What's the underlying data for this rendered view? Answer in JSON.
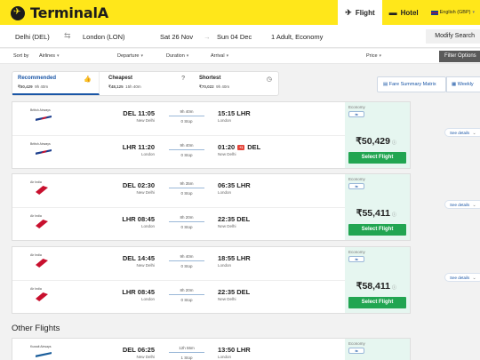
{
  "header": {
    "brand": "TerminalA",
    "nav": [
      {
        "label": "Flight",
        "icon": "✈",
        "active": true
      },
      {
        "label": "Hotel",
        "icon": "▬",
        "active": false
      }
    ],
    "language": "English (GBP)"
  },
  "search": {
    "from": "Delhi (DEL)",
    "to": "London (LON)",
    "depart_date": "Sat 26 Nov",
    "return_date": "Sun 04 Dec",
    "travellers": "1 Adult, Economy",
    "modify_label": "Modify Search"
  },
  "sort": {
    "sort_by": "Sort by",
    "airlines": "Airlines",
    "departure": "Departure",
    "duration": "Duration",
    "arrival": "Arrival",
    "price": "Price",
    "filter_label": "Filter Options"
  },
  "tabs": [
    {
      "name": "Recommended",
      "price": "₹50,429",
      "time": "9h 40m",
      "icon": "👍"
    },
    {
      "name": "Cheapest",
      "price": "₹48,125",
      "time": "15h 40m",
      "icon": "?"
    },
    {
      "name": "Shortest",
      "price": "₹70,022",
      "time": "9h 40m",
      "icon": "◷"
    }
  ],
  "tools": {
    "fare_summary": "Fare Summary Matrix",
    "weekly": "Weekly"
  },
  "cards": [
    {
      "cabin": "Economy",
      "price": "₹50,429",
      "select_label": "Select Flight",
      "details_label": "See details",
      "legs": [
        {
          "airline": "British Airways",
          "logo": "ba",
          "dep_time": "DEL 11:05",
          "dep_city": "New Delhi",
          "duration": "9h 40m",
          "stops": "0 Stop",
          "arr_time": "15:15 LHR",
          "arr_city": "London",
          "plus": ""
        },
        {
          "airline": "British Airways",
          "logo": "ba",
          "dep_time": "LHR 11:20",
          "dep_city": "London",
          "duration": "9h 40m",
          "stops": "0 Stop",
          "arr_time": "01:20",
          "arr_code": "DEL",
          "arr_city": "New Delhi",
          "plus": "+1"
        }
      ]
    },
    {
      "cabin": "Economy",
      "price": "₹55,411",
      "select_label": "Select Flight",
      "details_label": "See details",
      "legs": [
        {
          "airline": "Air India",
          "logo": "ai",
          "dep_time": "DEL 02:30",
          "dep_city": "New Delhi",
          "duration": "9h 35m",
          "stops": "0 Stop",
          "arr_time": "06:35 LHR",
          "arr_city": "London",
          "plus": ""
        },
        {
          "airline": "Air India",
          "logo": "ai",
          "dep_time": "LHR 08:45",
          "dep_city": "London",
          "duration": "8h 20m",
          "stops": "0 Stop",
          "arr_time": "22:35 DEL",
          "arr_city": "New Delhi",
          "plus": ""
        }
      ]
    },
    {
      "cabin": "Economy",
      "price": "₹58,411",
      "select_label": "Select Flight",
      "details_label": "See details",
      "legs": [
        {
          "airline": "Air India",
          "logo": "ai",
          "dep_time": "DEL 14:45",
          "dep_city": "New Delhi",
          "duration": "9h 40m",
          "stops": "0 Stop",
          "arr_time": "18:55 LHR",
          "arr_city": "London",
          "plus": ""
        },
        {
          "airline": "Air India",
          "logo": "ai",
          "dep_time": "LHR 08:45",
          "dep_city": "London",
          "duration": "8h 20m",
          "stops": "0 Stop",
          "arr_time": "22:35 DEL",
          "arr_city": "New Delhi",
          "plus": ""
        }
      ]
    }
  ],
  "other_heading": "Other Flights",
  "other_cards": [
    {
      "cabin": "Economy",
      "legs": [
        {
          "airline": "Kuwait Airways",
          "logo": "kw",
          "dep_time": "DEL 06:25",
          "dep_city": "New Delhi",
          "duration": "12h 55m",
          "stops": "1 Stop",
          "arr_time": "13:50 LHR",
          "arr_city": "London",
          "plus": ""
        }
      ]
    }
  ]
}
